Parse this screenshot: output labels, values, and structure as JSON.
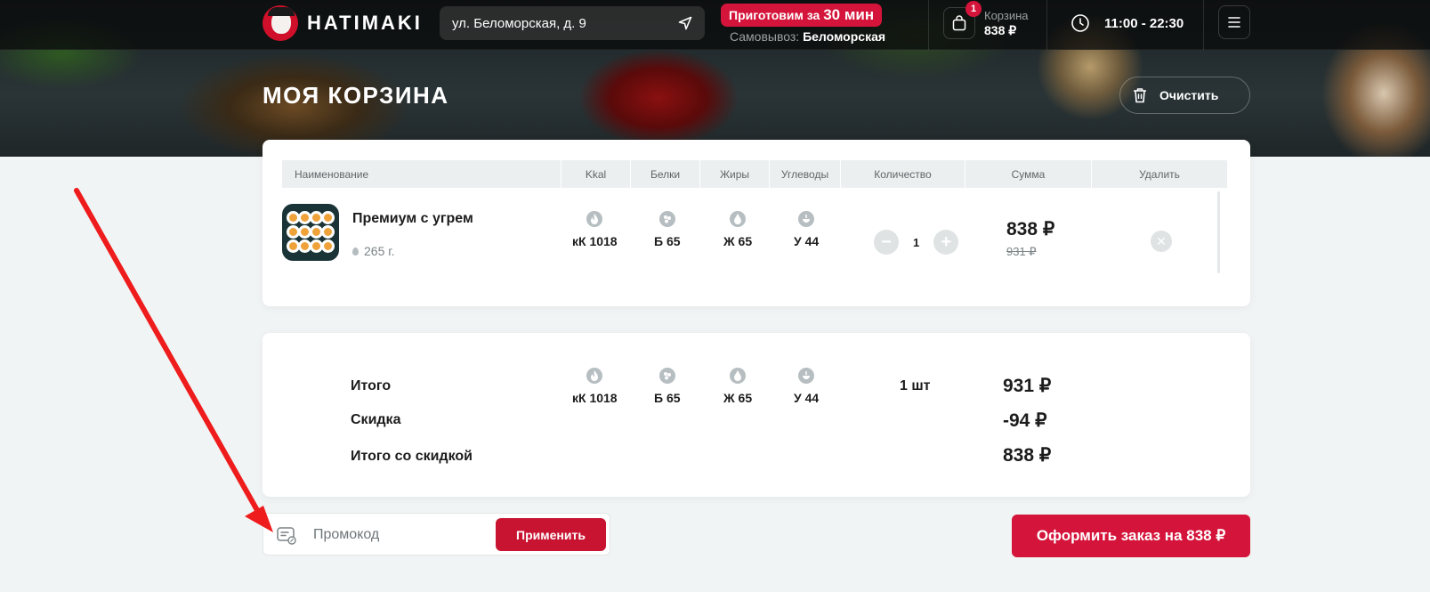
{
  "header": {
    "logo_text": "HATIMAKI",
    "address": "ул. Беломорская, д. 9",
    "cook_prefix": "Приготовим за",
    "cook_time": "30 мин",
    "pickup_label": "Самовывоз:",
    "pickup_place": "Беломорская",
    "cart_count": "1",
    "cart_label": "Корзина",
    "cart_total": "838 ₽",
    "hours": "11:00 - 22:30"
  },
  "page": {
    "title": "МОЯ КОРЗИНА",
    "clear_label": "Очистить"
  },
  "table": {
    "columns": [
      "Наименование",
      "Kkal",
      "Белки",
      "Жиры",
      "Углеводы",
      "Количество",
      "Сумма",
      "Удалить"
    ],
    "items": [
      {
        "name": "Премиум с угрем",
        "weight": "265 г.",
        "kcal": "кК 1018",
        "protein": "Б 65",
        "fat": "Ж 65",
        "carbs": "У 44",
        "quantity": "1",
        "price": "838 ₽",
        "old_price": "931 ₽"
      }
    ]
  },
  "summary": {
    "total_label": "Итого",
    "discount_label": "Скидка",
    "total_discounted_label": "Итого со скидкой",
    "kcal": "кК 1018",
    "protein": "Б 65",
    "fat": "Ж 65",
    "carbs": "У 44",
    "count": "1 шт",
    "total": "931 ₽",
    "discount": "-94 ₽",
    "total_discounted": "838 ₽"
  },
  "promo": {
    "placeholder": "Промокод",
    "apply_label": "Применить"
  },
  "order_button": "Оформить заказ на 838 ₽",
  "colors": {
    "accent": "#d4143a",
    "annotation_arrow": "#ee1c1c"
  },
  "icons": [
    "navigation-arrow-icon",
    "shopping-bag-icon",
    "clock-icon",
    "menu-icon",
    "trash-icon",
    "flame-icon",
    "protein-icon",
    "fat-drop-icon",
    "carbs-icon",
    "minus-icon",
    "plus-icon",
    "close-icon",
    "promo-ticket-icon"
  ]
}
